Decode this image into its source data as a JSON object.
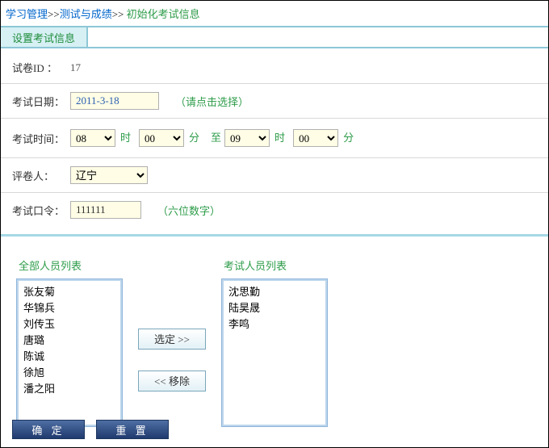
{
  "breadcrumb": {
    "l1": "学习管理",
    "l2": "测试与成绩",
    "cur": "初始化考试信息",
    "sep": ">>"
  },
  "tab": {
    "label": "设置考试信息"
  },
  "form": {
    "paper_id_label": "试卷ID ：",
    "paper_id_value": "17",
    "date_label": "考试日期：",
    "date_value": "2011-3-18",
    "date_hint": "（请点击选择）",
    "time_label": "考试时间：",
    "hour1": "08",
    "shi": "时",
    "min1": "00",
    "fen": "分",
    "zhi": "至",
    "hour2": "09",
    "min2": "00",
    "grader_label": "评卷人：",
    "grader": "辽宁",
    "pin_label": "考试口令：",
    "pin_value": "111111",
    "pin_hint": "（六位数字）"
  },
  "lists": {
    "all_title": "全部人员列表",
    "exam_title": "考试人员列表",
    "all": [
      "张友菊",
      "华锦兵",
      "刘传玉",
      "唐璐",
      "陈诚",
      "徐旭",
      "潘之阳"
    ],
    "exam": [
      "沈思勤",
      "陆昊晟",
      "李鸣"
    ]
  },
  "buttons": {
    "select": "选定 >>",
    "remove": "<< 移除",
    "ok": "确  定",
    "reset": "重  置"
  }
}
